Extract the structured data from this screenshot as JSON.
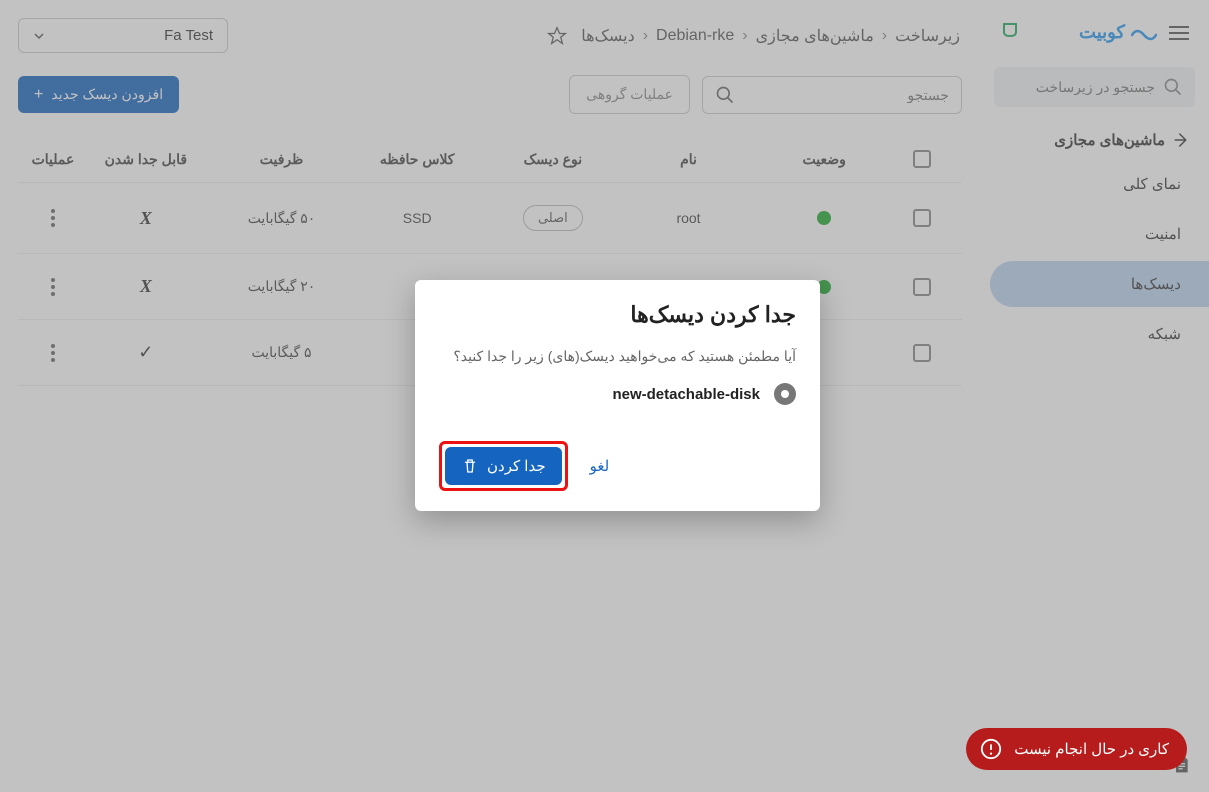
{
  "brand": {
    "name": "کوبیت"
  },
  "sidebar": {
    "search_placeholder": "جستجو در زیرساخت",
    "section_title": "ماشین‌های مجازی",
    "items": [
      {
        "label": "نمای کلی"
      },
      {
        "label": "امنیت"
      },
      {
        "label": "دیسک‌ها"
      },
      {
        "label": "شبکه"
      }
    ],
    "footer_label": "مستندات"
  },
  "breadcrumb": {
    "items": [
      "زیرساخت",
      "ماشین‌های مجازی",
      "Debian-rke",
      "دیسک‌ها"
    ]
  },
  "project_select": {
    "label": "Fa Test"
  },
  "toolbar": {
    "search_placeholder": "جستجو",
    "bulk_label": "عملیات گروهی",
    "add_label": "افزودن دیسک جدید"
  },
  "table": {
    "headers": {
      "status": "وضعیت",
      "name": "نام",
      "disk_type": "نوع دیسک",
      "storage_class": "کلاس حافظه",
      "capacity": "ظرفیت",
      "detachable": "قابل جدا شدن",
      "actions": "عملیات"
    },
    "rows": [
      {
        "status": "green",
        "name": "root",
        "disk_type": "اصلی",
        "storage_class": "SSD",
        "capacity": "۵۰ گیگابایت",
        "detachable": "no"
      },
      {
        "status": "green",
        "name": "",
        "disk_type": "",
        "storage_class": "",
        "capacity": "۲۰ گیگابایت",
        "detachable": "no"
      },
      {
        "status": "",
        "name": "",
        "disk_type": "",
        "storage_class": "",
        "capacity": "۵ گیگابایت",
        "detachable": "yes"
      }
    ]
  },
  "modal": {
    "title": "جدا کردن دیسک‌ها",
    "message": "آیا مطمئن هستید که می‌خواهید دیسک(های) زیر را جدا کنید؟",
    "disk_name": "new-detachable-disk",
    "cancel_label": "لغو",
    "confirm_label": "جدا کردن"
  },
  "snackbar": {
    "text": "کاری در حال انجام نیست"
  }
}
